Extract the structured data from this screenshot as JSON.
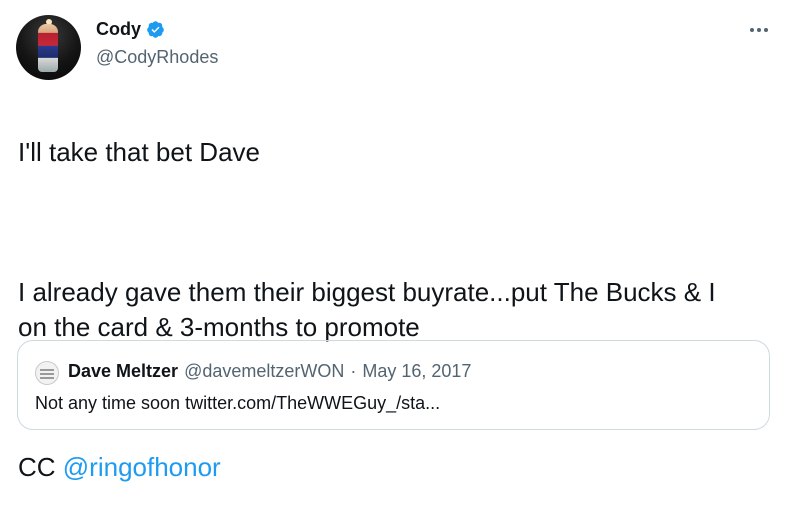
{
  "author": {
    "name": "Cody",
    "handle": "@CodyRhodes",
    "verified": true,
    "avatar": "avatar-photo"
  },
  "more_icon": "more-horizontal-icon",
  "tweet": {
    "line1": "I'll take that bet Dave",
    "line2": "I already gave them their biggest buyrate...put The Bucks & I on the card & 3-months to promote",
    "line3_prefix": "CC ",
    "mention": "@ringofhonor"
  },
  "quoted": {
    "name": "Dave Meltzer",
    "handle": "@davemeltzerWON",
    "separator": "·",
    "date": "May 16, 2017",
    "text": "Not any time soon twitter.com/TheWWEGuy_/sta..."
  },
  "colors": {
    "text": "#0f1419",
    "secondary": "#536471",
    "link": "#1d9bf0",
    "border": "#cfd9de"
  }
}
